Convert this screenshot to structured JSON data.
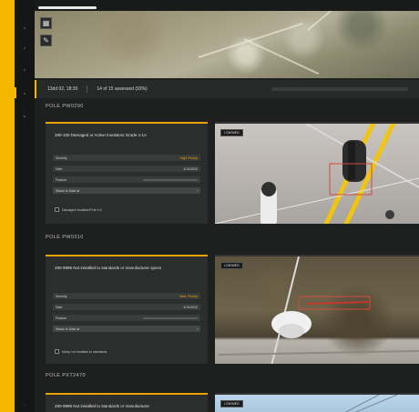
{
  "sidebar": {
    "icons": [
      "grid-icon",
      "layers-icon",
      "location-icon",
      "target-icon",
      "chart-icon",
      "chevron-icon",
      "settings-icon"
    ]
  },
  "map": {
    "buttons": [
      {
        "name": "layers-icon",
        "glyph": "▦"
      },
      {
        "name": "edit-icon",
        "glyph": "✎"
      }
    ]
  },
  "infobar": {
    "date": "13dd 02, 18:30",
    "progress": "14 of 15 assessed (93%)",
    "scrub": "—————— · ——— ————— ————— — — ————"
  },
  "sections": [
    {
      "title": "POLE PW0290",
      "card": {
        "title": "290-100 Damaged or Active Insulators Grade 4-1A",
        "rows": [
          {
            "label": "Severity",
            "value": "High Priority",
            "kind": "accent"
          },
          {
            "label": "Date",
            "value": "4/13/2022",
            "kind": "text"
          },
          {
            "label": "Feature",
            "value": "",
            "kind": "bar"
          },
          {
            "label": "Status to Date at",
            "value": "›",
            "kind": "select"
          }
        ],
        "check": "Damaged Insulator/Pole 9-4"
      },
      "photo_tag": "LOW/MED"
    },
    {
      "title": "POLE PW0310",
      "card": {
        "title": "290-9999 Not installed to standards or manufacturer specs",
        "rows": [
          {
            "label": "Severity",
            "value": "Med. Priority",
            "kind": "accent"
          },
          {
            "label": "Date",
            "value": "4/13/2022",
            "kind": "text"
          },
          {
            "label": "Feature",
            "value": "",
            "kind": "bar"
          },
          {
            "label": "Status to Date at",
            "value": "›",
            "kind": "select"
          }
        ],
        "check": "Noisy, not installed to standards"
      },
      "photo_tag": "LOW/MED"
    },
    {
      "title": "POLE PXT2470",
      "card": {
        "title": "290-9999 Not installed to standards or manufacturer"
      },
      "photo_tag": "LOW/MED"
    }
  ]
}
